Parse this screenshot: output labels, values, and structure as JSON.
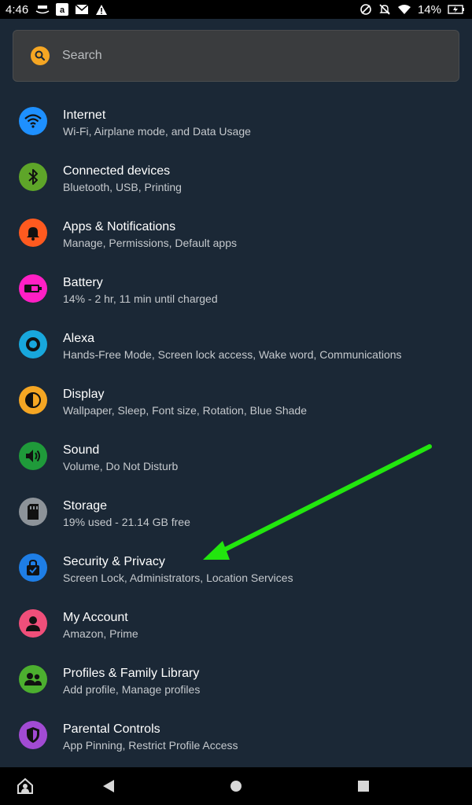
{
  "status_bar": {
    "time": "4:46",
    "battery": "14%",
    "left_icons": [
      "photos-icon",
      "amazon-icon",
      "mail-icon",
      "warning-icon"
    ],
    "right_icons": [
      "no-sim-icon",
      "bell-off-icon",
      "wifi-icon",
      "battery-charging-icon"
    ]
  },
  "search": {
    "placeholder": "Search"
  },
  "settings": [
    {
      "title": "Internet",
      "subtitle": "Wi-Fi, Airplane mode, and Data Usage",
      "icon": "wifi-icon",
      "color": "#1e90ff"
    },
    {
      "title": "Connected devices",
      "subtitle": "Bluetooth, USB, Printing",
      "icon": "bluetooth-icon",
      "color": "#5ea529"
    },
    {
      "title": "Apps & Notifications",
      "subtitle": "Manage, Permissions, Default apps",
      "icon": "bell-icon",
      "color": "#ff5a1f"
    },
    {
      "title": "Battery",
      "subtitle": "14% - 2 hr, 11 min until charged",
      "icon": "battery-icon",
      "color": "#ff1fc4"
    },
    {
      "title": "Alexa",
      "subtitle": "Hands-Free Mode, Screen lock access, Wake word, Communications",
      "icon": "alexa-icon",
      "color": "#18a7dc"
    },
    {
      "title": "Display",
      "subtitle": "Wallpaper, Sleep, Font size, Rotation, Blue Shade",
      "icon": "contrast-icon",
      "color": "#f5a623"
    },
    {
      "title": "Sound",
      "subtitle": "Volume, Do Not Disturb",
      "icon": "speaker-icon",
      "color": "#1f9a3a"
    },
    {
      "title": "Storage",
      "subtitle": "19% used - 21.14 GB free",
      "icon": "sd-card-icon",
      "color": "#8d9399"
    },
    {
      "title": "Security & Privacy",
      "subtitle": "Screen Lock, Administrators, Location Services",
      "icon": "lock-bag-icon",
      "color": "#1e7ee6"
    },
    {
      "title": "My Account",
      "subtitle": "Amazon, Prime",
      "icon": "person-icon",
      "color": "#f04f7a"
    },
    {
      "title": "Profiles & Family Library",
      "subtitle": "Add profile, Manage profiles",
      "icon": "people-icon",
      "color": "#4caf2f"
    },
    {
      "title": "Parental Controls",
      "subtitle": "App Pinning, Restrict Profile Access",
      "icon": "shield-icon",
      "color": "#a24bd3"
    }
  ],
  "annotation": {
    "arrow_color": "#22e60e"
  },
  "nav_bar": {
    "buttons": [
      "home-profile-icon",
      "back-icon",
      "home-icon",
      "recents-icon"
    ]
  }
}
